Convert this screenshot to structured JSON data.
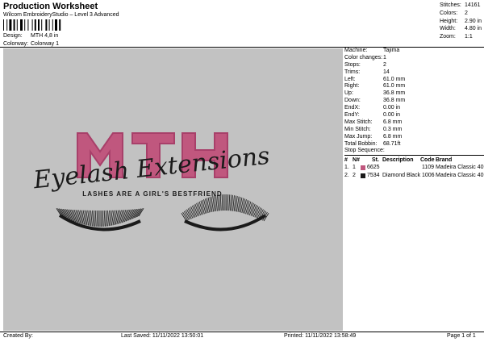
{
  "header": {
    "title": "Production Worksheet",
    "subtitle": "Wilcom EmbroideryStudio – Level 3 Advanced",
    "design_label": "Design:",
    "design_value": "MTH 4,8 in",
    "colorway_label": "Colorway:",
    "colorway_value": "Colorway 1"
  },
  "summary": [
    {
      "label": "Stitches:",
      "value": "14161"
    },
    {
      "label": "Colors:",
      "value": "2"
    },
    {
      "label": "Height:",
      "value": "2.90 in"
    },
    {
      "label": "Width:",
      "value": "4.80 in"
    },
    {
      "label": "Zoom:",
      "value": "1:1"
    }
  ],
  "specs": [
    {
      "label": "Machine:",
      "value": "Tajima"
    },
    {
      "label": "Color changes:",
      "value": "1"
    },
    {
      "label": "Stops:",
      "value": "2"
    },
    {
      "label": "Trims:",
      "value": "14"
    },
    {
      "label": "Left:",
      "value": "61.0 mm"
    },
    {
      "label": "Right:",
      "value": "61.0 mm"
    },
    {
      "label": "Up:",
      "value": "36.8 mm"
    },
    {
      "label": "Down:",
      "value": "36.8 mm"
    },
    {
      "label": "EndX:",
      "value": "0.00 in"
    },
    {
      "label": "EndY:",
      "value": "0.00 in"
    },
    {
      "label": "Max Stitch:",
      "value": "6.8 mm"
    },
    {
      "label": "Min Stitch:",
      "value": "0.3 mm"
    },
    {
      "label": "Max Jump:",
      "value": "6.8 mm"
    },
    {
      "label": "Total Bobbin:",
      "value": "68.71ft"
    }
  ],
  "stop_sequence": {
    "label": "Stop Sequence:",
    "headers": {
      "num": "#",
      "n": "N#",
      "st": "St.",
      "desc": "Description",
      "code": "Code",
      "brand": "Brand"
    },
    "rows": [
      {
        "num": "1.",
        "n": "1",
        "color": "#c0577e",
        "st": "6625",
        "desc": "",
        "code": "1109",
        "brand": "Madeira Classic 40"
      },
      {
        "num": "2.",
        "n": "2",
        "color": "#1a1a1a",
        "st": "7534",
        "desc": "Diamond Black",
        "code": "1006",
        "brand": "Madeira Classic 40"
      }
    ]
  },
  "design": {
    "letters": "MTH",
    "script": "Eyelash Extensions",
    "tagline": "LASHES ARE A GIRL'S BESTFRIEND",
    "pink": "#c0577e",
    "pink_dark": "#a8406a",
    "black": "#1a1a1a",
    "background": "#c2c2c2"
  },
  "footer": {
    "created_by": "Created By:",
    "last_saved": "Last Saved: 11/11/2022 13:50:01",
    "printed": "Printed: 11/11/2022 13:58:49",
    "page": "Page 1 of 1"
  }
}
